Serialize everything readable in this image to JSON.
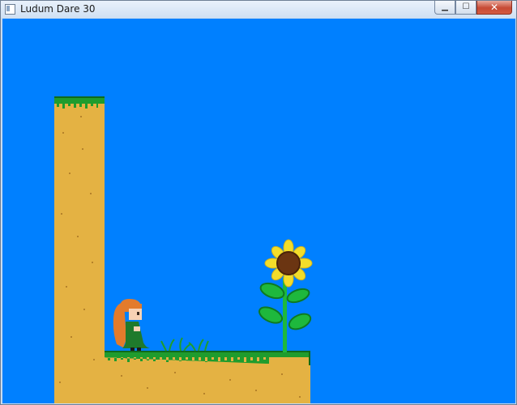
{
  "window": {
    "title": "Ludum Dare 30",
    "minimize_glyph": "▁",
    "maximize_glyph": "☐",
    "close_glyph": "✕"
  },
  "icons": {
    "app": "window-icon",
    "minimize": "minimize-icon",
    "maximize": "maximize-icon",
    "close": "close-icon"
  },
  "colors": {
    "sky": "#0080ff",
    "dirt": "#e4b243",
    "grass": "#1f9c2d",
    "grass_dark": "#0f6a1b",
    "sunflower_petal": "#f3dd2a",
    "sunflower_center": "#6b3512",
    "stem": "#1eb83d",
    "girl_hair": "#e37b2c",
    "girl_dress": "#1f7a2c"
  }
}
